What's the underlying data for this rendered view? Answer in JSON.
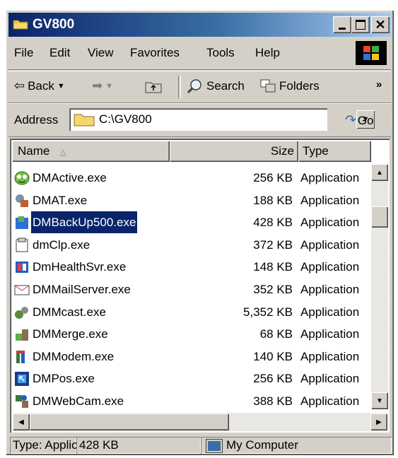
{
  "window": {
    "title": "GV800"
  },
  "menu": [
    "File",
    "Edit",
    "View",
    "Favorites",
    "Tools",
    "Help"
  ],
  "toolbar": {
    "back": "Back",
    "search": "Search",
    "folders": "Folders",
    "more": "»"
  },
  "address": {
    "label": "Address",
    "value": "C:\\GV800",
    "go": "Go"
  },
  "columns": {
    "name": "Name",
    "size": "Size",
    "type": "Type"
  },
  "files": [
    {
      "name": "DMActive.exe",
      "size": "256 KB",
      "type": "Application"
    },
    {
      "name": "DMAT.exe",
      "size": "188 KB",
      "type": "Application"
    },
    {
      "name": "DMBackUp500.exe",
      "size": "428 KB",
      "type": "Application"
    },
    {
      "name": "dmClp.exe",
      "size": "372 KB",
      "type": "Application"
    },
    {
      "name": "DmHealthSvr.exe",
      "size": "148 KB",
      "type": "Application"
    },
    {
      "name": "DMMailServer.exe",
      "size": "352 KB",
      "type": "Application"
    },
    {
      "name": "DMMcast.exe",
      "size": "5,352 KB",
      "type": "Application"
    },
    {
      "name": "DMMerge.exe",
      "size": "68 KB",
      "type": "Application"
    },
    {
      "name": "DMModem.exe",
      "size": "140 KB",
      "type": "Application"
    },
    {
      "name": "DMPos.exe",
      "size": "256 KB",
      "type": "Application"
    },
    {
      "name": "DMWebCam.exe",
      "size": "388 KB",
      "type": "Application"
    }
  ],
  "status": {
    "type": "Type: Applic.",
    "size": "428 KB",
    "location": "My Computer"
  }
}
